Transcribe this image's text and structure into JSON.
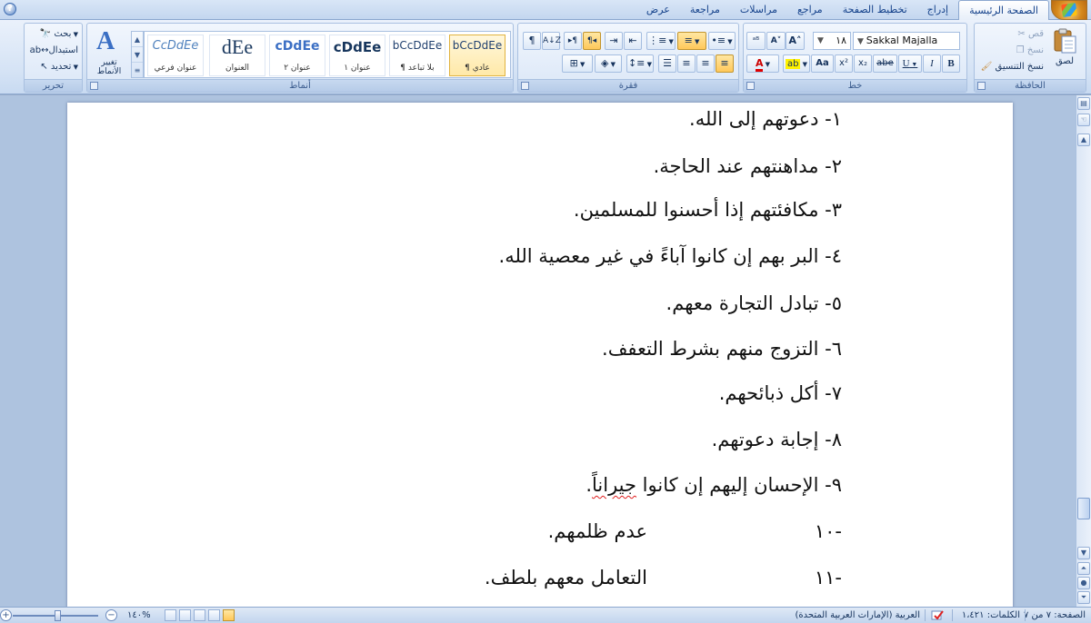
{
  "tabs": [
    {
      "label": "الصفحة الرئيسية",
      "active": true
    },
    {
      "label": "إدراج"
    },
    {
      "label": "تخطيط الصفحة"
    },
    {
      "label": "مراجع"
    },
    {
      "label": "مراسلات"
    },
    {
      "label": "مراجعة"
    },
    {
      "label": "عرض"
    }
  ],
  "clipboard": {
    "label": "الحافظة",
    "paste": "لصق",
    "cut": "قص",
    "copy": "نسخ",
    "format_painter": "نسخ التنسيق"
  },
  "font": {
    "label": "خط",
    "name": "Sakkal Majalla",
    "size": "١٨",
    "bold": "B",
    "italic": "I",
    "underline": "U",
    "strike": "abe",
    "subscript": "x₂",
    "superscript": "x²",
    "change_case": "Aa",
    "grow": "A˄",
    "shrink": "A˅",
    "clear": "A"
  },
  "paragraph": {
    "label": "فقرة"
  },
  "styles": {
    "label": "أنماط",
    "change_styles": "تغيير الأنماط",
    "items": [
      {
        "sample": "bCcDdEe",
        "name": "¶ عادي",
        "selected": true
      },
      {
        "sample": "bCcDdEe",
        "name": "¶ بلا تباعد"
      },
      {
        "sample": "cDdEe",
        "name": "عنوان ١"
      },
      {
        "sample": "cDdEe",
        "name": "عنوان ٢"
      },
      {
        "sample": "dEe",
        "name": "العنوان"
      },
      {
        "sample": "CcDdEe",
        "name": "عنوان فرعي"
      }
    ]
  },
  "editing": {
    "label": "تحرير",
    "find": "بحث",
    "replace": "استبدال",
    "select": "تحديد"
  },
  "document": {
    "lines": [
      "١- دعوتهم إلى الله.",
      "٢- مداهنتهم عند الحاجة.",
      "٣- مكافئتهم إذا أحسنوا للمسلمين.",
      "٤- البر بهم إن كانوا آباءً في غير معصية الله.",
      "٥- تبادل التجارة معهم.",
      "٦- التزوج منهم بشرط التعفف.",
      "٧- أكل ذبائحهم.",
      "٨- إجابة دعوتهم.",
      "٩- الإحسان إليهم إن كانوا "
    ],
    "line9_misspelled": "جيراناً",
    "line9_end": ".",
    "line10_num": "-١٠",
    "line10_text": "عدم ظلمهم.",
    "line11_num": "-١١",
    "line11_text": "التعامل معهم بلطف."
  },
  "status": {
    "page": "الصفحة: ٧ من ٧",
    "words": "الكلمات: ١،٤٢١",
    "language": "العربية (الإمارات العربية المتحدة)",
    "zoom": "١٤٠%"
  }
}
